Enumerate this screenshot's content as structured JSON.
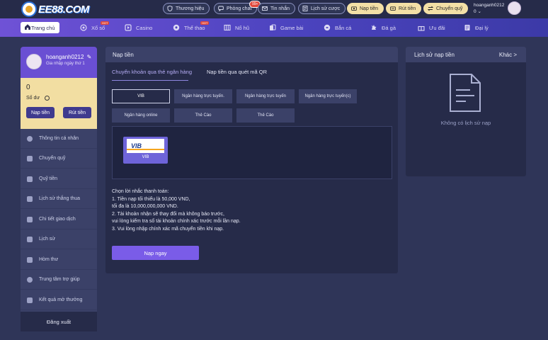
{
  "header": {
    "logo_text": "EE88.COM",
    "buttons": [
      {
        "label": "Thương hiệu",
        "icon": "shield-icon"
      },
      {
        "label": "Phòng chat",
        "icon": "chat-icon",
        "badge": "99+"
      },
      {
        "label": "Tin nhắn",
        "icon": "mail-icon"
      },
      {
        "label": "Lịch sử cược",
        "icon": "history-icon"
      },
      {
        "label": "Nạp tiền",
        "icon": "deposit-icon"
      },
      {
        "label": "Rút tiền",
        "icon": "withdraw-icon"
      },
      {
        "label": "Chuyển quỹ",
        "icon": "transfer-icon"
      }
    ],
    "username": "hoanganh0212",
    "balance": "0"
  },
  "nav": {
    "items": [
      {
        "label": "Trang chủ",
        "icon": "home-icon"
      },
      {
        "label": "Xổ số",
        "icon": "lottery-icon",
        "badge": "HOT"
      },
      {
        "label": "Casino",
        "icon": "casino-icon"
      },
      {
        "label": "Thể thao",
        "icon": "soccer-icon",
        "badge": "HOT"
      },
      {
        "label": "Nổ hũ",
        "icon": "slot-icon"
      },
      {
        "label": "Game bài",
        "icon": "cards-icon"
      },
      {
        "label": "Bắn cá",
        "icon": "fish-icon"
      },
      {
        "label": "Đá gà",
        "icon": "rooster-icon"
      },
      {
        "label": "Ưu đãi",
        "icon": "gift-icon"
      },
      {
        "label": "Đại lý",
        "icon": "agent-icon"
      }
    ]
  },
  "sidebar": {
    "username": "hoanganh0212",
    "subtitle": "Gia nhập ngày thứ 1",
    "balance": "0",
    "balance_label": "Số dư",
    "deposit_label": "Nạp tiền",
    "withdraw_label": "Rút tiền",
    "menu": [
      {
        "label": "Thông tin cá nhân",
        "icon": "user-icon"
      },
      {
        "label": "Chuyển quỹ",
        "icon": "transfer-icon"
      },
      {
        "label": "Quỹ tiền",
        "icon": "wallet-icon"
      },
      {
        "label": "Lịch sử thắng thua",
        "icon": "chart-icon"
      },
      {
        "label": "Chi tiết giao dịch",
        "icon": "receipt-icon"
      },
      {
        "label": "Lịch sử",
        "icon": "history-icon"
      },
      {
        "label": "Hòm thư",
        "icon": "mail-icon"
      },
      {
        "label": "Trung tâm trợ giúp",
        "icon": "help-icon"
      },
      {
        "label": "Kết quả mở thưởng",
        "icon": "trophy-icon"
      }
    ],
    "logout_label": "Đăng xuất"
  },
  "deposit": {
    "title": "Nạp tiền",
    "tabs": [
      "Chuyển khoản qua thẻ ngân hàng",
      "Nạp tiền qua quét mã QR"
    ],
    "banks": [
      "VIB",
      "Ngân hàng trực tuyến.",
      "Ngân hàng trực tuyến",
      "Ngân hàng trực tuyến(c)",
      "Ngân hàng online",
      "Thẻ Cào",
      "Thẻ Cào"
    ],
    "selected_bank": {
      "logo": "VIB",
      "name": "VIB"
    },
    "notes": [
      "Chọn lời nhắc thanh toán:",
      "1. Tiền nạp tối thiểu là 50,000 VND,",
      "tối đa là 10,000,000,000 VND.",
      "2. Tài khoản nhận sẽ thay đổi mà không báo trước,",
      "vui lòng kiểm tra số tài khoản chính xác trước mỗi lần nạp.",
      "3. Vui lòng nhập chính xác mã chuyển tiền khi nạp."
    ],
    "submit_label": "Nạp ngay"
  },
  "history": {
    "title": "Lịch sử nạp tiền",
    "more_label": "Khác >",
    "empty_text": "Không có lịch sử nạp"
  },
  "colors": {
    "background": "#2f3558",
    "panel": "#262b49",
    "accent": "#7a5ce8",
    "gold": "#f2dea2"
  }
}
